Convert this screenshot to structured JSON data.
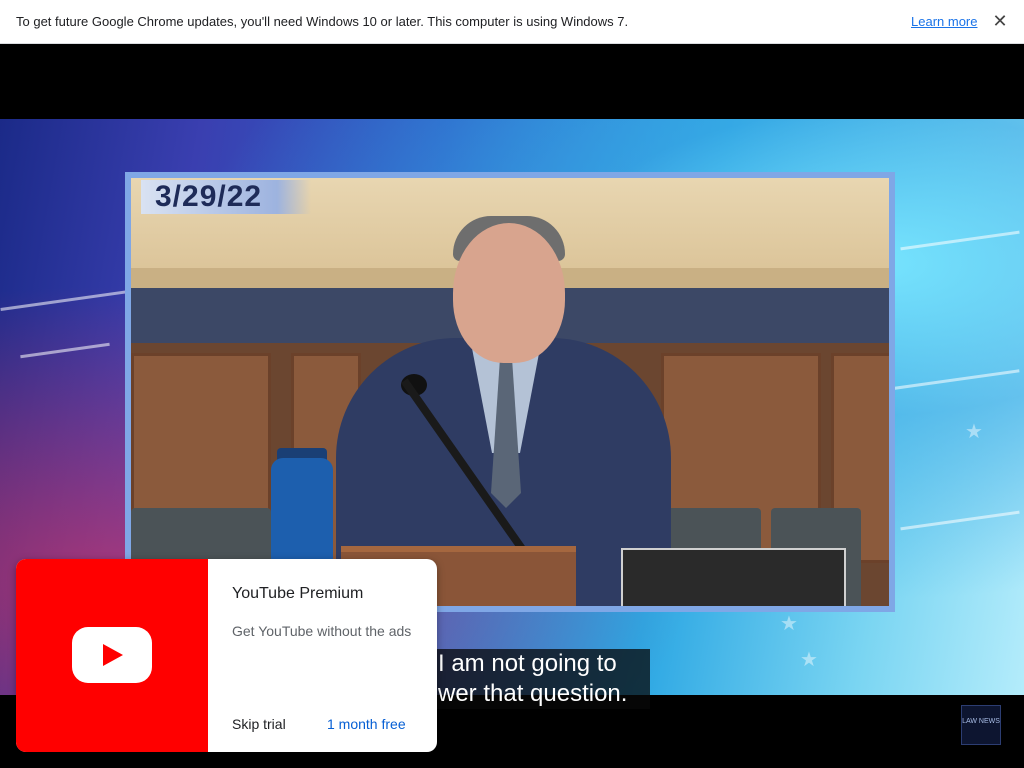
{
  "infobar": {
    "message": "To get future Google Chrome updates, you'll need Windows 10 or later. This computer is using Windows 7.",
    "learn_more": "Learn more",
    "close_glyph": "✕"
  },
  "video": {
    "date_overlay": "3/29/22",
    "captions": [
      "I am not going to",
      "wer that question."
    ],
    "watermark": "LAW NEWS"
  },
  "premium_card": {
    "title": "YouTube Premium",
    "subtitle": "Get YouTube without the ads",
    "skip_label": "Skip trial",
    "trial_label": "1 month free",
    "brand_color": "#ff0000",
    "logo_icon": "youtube-logo-icon"
  },
  "colors": {
    "link": "#1a73e8",
    "trial_link": "#065fd4"
  }
}
